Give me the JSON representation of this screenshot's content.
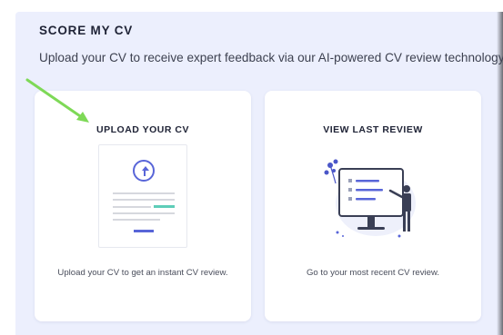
{
  "section": {
    "title": "SCORE MY CV",
    "subtitle": "Upload your CV to receive expert feedback via our AI-powered CV review technology."
  },
  "cards": [
    {
      "title": "UPLOAD YOUR CV",
      "description": "Upload your CV to get an instant CV review.",
      "icon": "upload-document-icon"
    },
    {
      "title": "VIEW LAST REVIEW",
      "description": "Go to your most recent CV review.",
      "icon": "presentation-review-icon"
    }
  ],
  "colors": {
    "panel_bg": "#eceffd",
    "accent_blue": "#5865d8",
    "accent_teal": "#5ecdb8",
    "annotation_green": "#7ed957"
  }
}
